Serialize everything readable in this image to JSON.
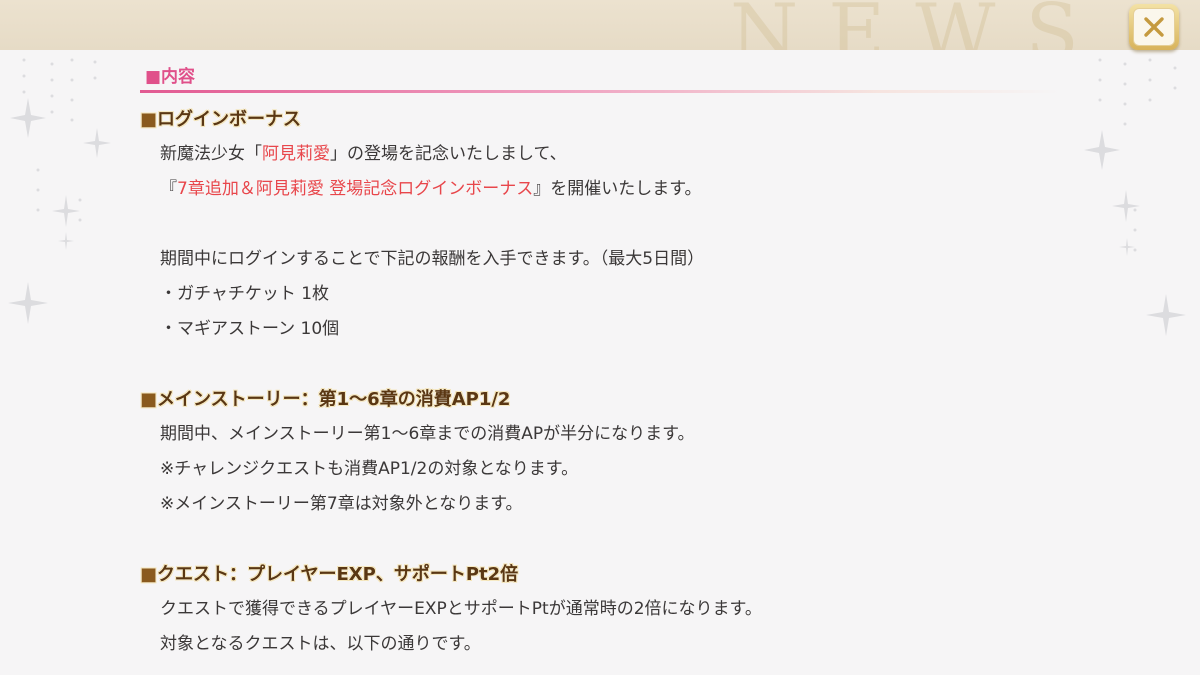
{
  "header": {
    "watermark": "NEWS"
  },
  "close_button": {
    "icon": "close-icon"
  },
  "section_title": "■内容",
  "login_bonus": {
    "heading": "ログインボーナス",
    "line1_pre": "新魔法少女「",
    "line1_name": "阿見莉愛",
    "line1_post": "」の登場を記念いたしまして、",
    "line2_open": "『",
    "line2_event": "7章追加＆阿見莉愛 登場記念ログインボーナス",
    "line2_close": "』を開催いたします。",
    "line3": "期間中にログインすることで下記の報酬を入手できます。（最大5日間）",
    "reward1": "・ガチャチケット 1枚",
    "reward2": "・マギアストーン 10個"
  },
  "main_story": {
    "heading": "メインストーリー：第1～6章の消費AP1/2",
    "line1": "期間中、メインストーリー第1～6章までの消費APが半分になります。",
    "line2": "※チャレンジクエストも消費AP1/2の対象となります。",
    "line3": "※メインストーリー第7章は対象外となります。"
  },
  "quest": {
    "heading": "クエスト：プレイヤーEXP、サポートPt2倍",
    "line1": "クエストで獲得できるプレイヤーEXPとサポートPtが通常時の2倍になります。",
    "line2": "対象となるクエストは、以下の通りです。"
  },
  "colors": {
    "accent_pink": "#e0508a",
    "highlight_red": "#e8464b",
    "heading_brown": "#5a3713",
    "close_gold": "#d8b35b"
  }
}
